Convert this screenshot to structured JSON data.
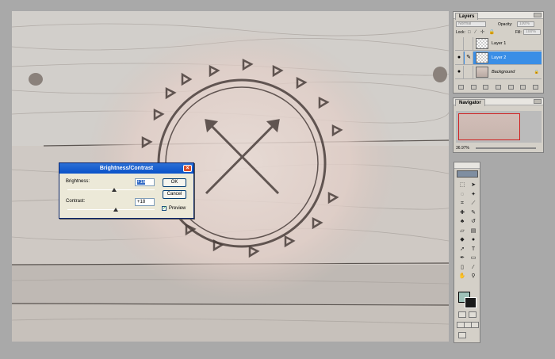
{
  "colors": {
    "workspace": "#a9a9a9",
    "panel": "#d4d0c8",
    "active_layer": "#3a8ee6",
    "foreground": "#9fc2b9",
    "background": "#1a1a1a"
  },
  "dialog": {
    "title": "Brightness/Contrast",
    "brightness_label": "Brightness:",
    "brightness_value": "+16",
    "brightness_level": 0.54,
    "contrast_label": "Contrast:",
    "contrast_value": "+18",
    "contrast_level": 0.55,
    "ok_label": "OK",
    "cancel_label": "Cancel",
    "preview_label": "Preview",
    "preview_checked": true,
    "close_icon": "close-icon"
  },
  "layers_panel": {
    "tab": "Layers",
    "blend_mode": "Normal",
    "opacity_label": "Opacity:",
    "opacity_value": "100%",
    "lock_label": "Lock:",
    "fill_label": "Fill:",
    "fill_value": "100%",
    "layers": [
      {
        "name": "Layer 1",
        "visible": false,
        "active": false
      },
      {
        "name": "Layer 2",
        "visible": true,
        "active": true
      },
      {
        "name": "Background",
        "visible": true,
        "active": false,
        "locked": true
      }
    ]
  },
  "navigator_panel": {
    "tab": "Navigator",
    "zoom": "36.97%"
  },
  "tools": {
    "icons": [
      "marquee-icon",
      "move-icon",
      "lasso-icon",
      "magic-wand-icon",
      "crop-icon",
      "slice-icon",
      "healing-icon",
      "brush-icon",
      "stamp-icon",
      "history-brush-icon",
      "eraser-icon",
      "gradient-icon",
      "blur-icon",
      "dodge-icon",
      "path-select-icon",
      "type-icon",
      "pen-icon",
      "shape-icon",
      "notes-icon",
      "eyedropper-icon",
      "hand-icon",
      "zoom-icon"
    ]
  }
}
